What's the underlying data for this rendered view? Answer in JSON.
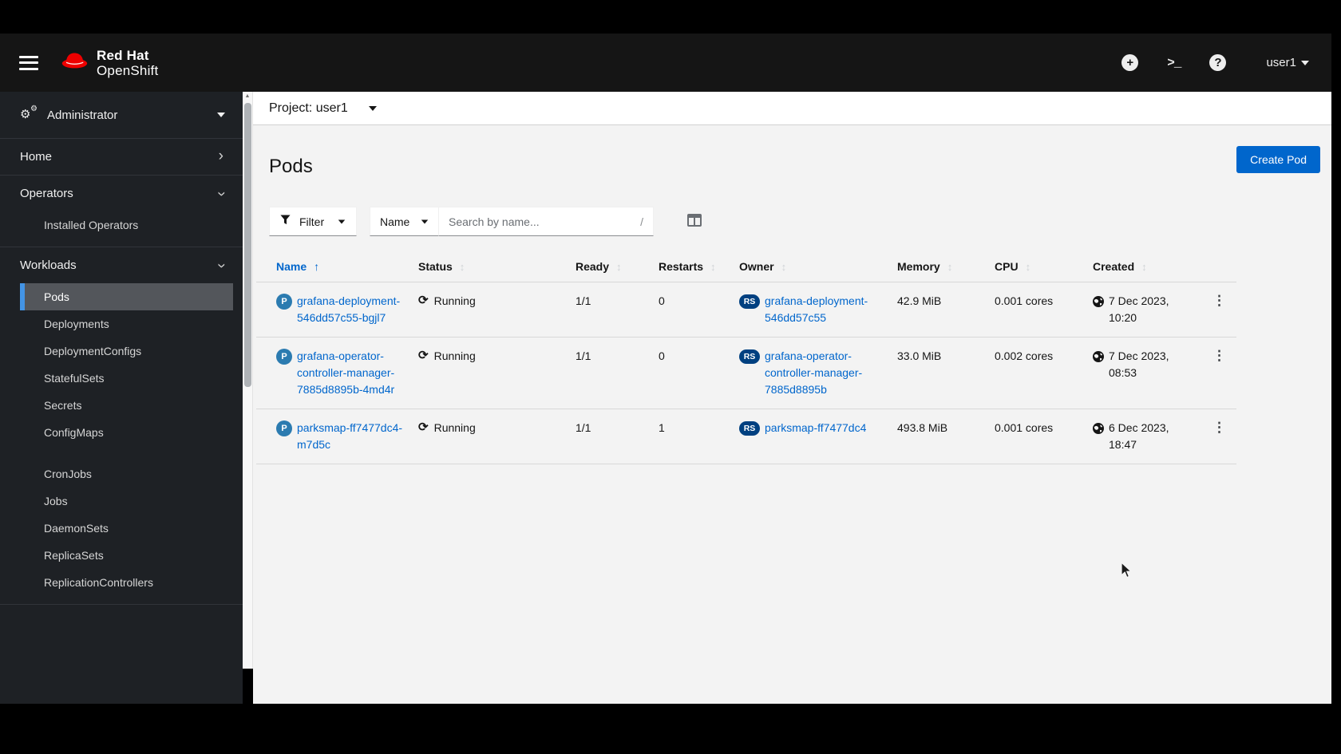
{
  "masthead": {
    "brand_line1": "Red Hat",
    "brand_line2": "OpenShift",
    "user": "user1",
    "plus_glyph": "+",
    "terminal_glyph": ">_",
    "help_glyph": "?"
  },
  "sidebar": {
    "perspective": "Administrator",
    "groups": [
      {
        "label": "Home",
        "expanded": false,
        "items": []
      },
      {
        "label": "Operators",
        "expanded": true,
        "items": [
          {
            "label": "Installed Operators"
          }
        ]
      },
      {
        "label": "Workloads",
        "expanded": true,
        "items": [
          {
            "label": "Pods",
            "active": true
          },
          {
            "label": "Deployments"
          },
          {
            "label": "DeploymentConfigs"
          },
          {
            "label": "StatefulSets"
          },
          {
            "label": "Secrets"
          },
          {
            "label": "ConfigMaps"
          },
          {
            "divider": true
          },
          {
            "label": "CronJobs"
          },
          {
            "label": "Jobs"
          },
          {
            "label": "DaemonSets"
          },
          {
            "label": "ReplicaSets"
          },
          {
            "label": "ReplicationControllers"
          }
        ]
      }
    ]
  },
  "content": {
    "project_bar": {
      "label": "Project: user1"
    },
    "page_title": "Pods",
    "create_button": "Create Pod",
    "toolbar": {
      "filter_label": "Filter",
      "name_label": "Name",
      "search_placeholder": "Search by name...",
      "shortcut_hint": "/"
    },
    "table": {
      "columns": [
        {
          "label": "Name",
          "sorted": true
        },
        {
          "label": "Status"
        },
        {
          "label": "Ready"
        },
        {
          "label": "Restarts"
        },
        {
          "label": "Owner"
        },
        {
          "label": "Memory"
        },
        {
          "label": "CPU"
        },
        {
          "label": "Created"
        }
      ],
      "rows": [
        {
          "name": "grafana-deployment-546dd57c55-bgjl7",
          "status": "Running",
          "ready": "1/1",
          "restarts": "0",
          "owner": "grafana-deployment-546dd57c55",
          "memory": "42.9 MiB",
          "cpu": "0.001 cores",
          "created_date": "7 Dec 2023,",
          "created_time": "10:20"
        },
        {
          "name": "grafana-operator-controller-manager-7885d8895b-4md4r",
          "status": "Running",
          "ready": "1/1",
          "restarts": "0",
          "owner": "grafana-operator-controller-manager-7885d8895b",
          "memory": "33.0 MiB",
          "cpu": "0.002 cores",
          "created_date": "7 Dec 2023,",
          "created_time": "08:53"
        },
        {
          "name": "parksmap-ff7477dc4-m7d5c",
          "status": "Running",
          "ready": "1/1",
          "restarts": "1",
          "owner": "parksmap-ff7477dc4",
          "memory": "493.8 MiB",
          "cpu": "0.001 cores",
          "created_date": "6 Dec 2023,",
          "created_time": "18:47"
        }
      ],
      "pod_badge": "P",
      "owner_badge": "RS"
    }
  },
  "colors": {
    "primary_blue": "#0066cc",
    "masthead_bg": "#151515",
    "sidebar_bg": "#1e2125",
    "active_nav_bar": "#4394e5",
    "pod_badge_bg": "#2b7bb0",
    "replicaset_badge_bg": "#004080",
    "brand_red": "#ee0000",
    "link_blue": "#0066cc"
  }
}
